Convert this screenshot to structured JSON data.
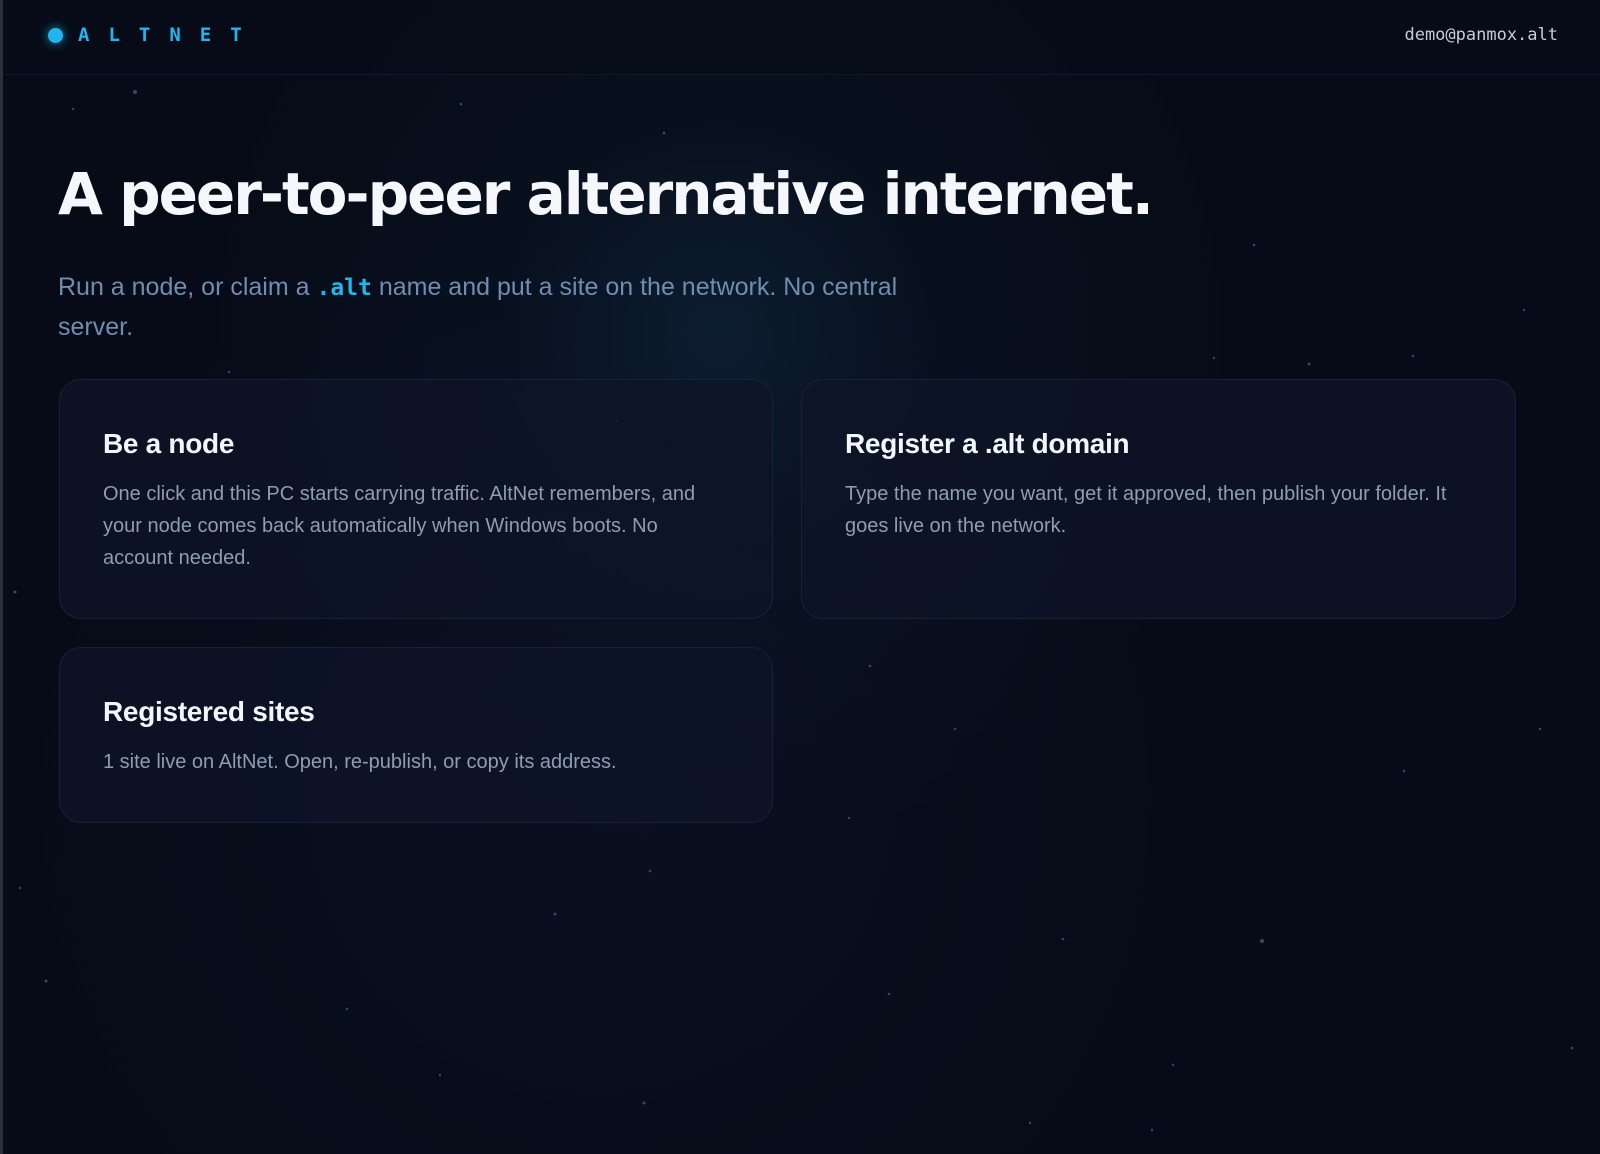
{
  "topbar": {
    "brand": "ALTNET",
    "account": "demo@panmox.alt"
  },
  "hero": {
    "title": "A peer-to-peer alternative internet.",
    "subtitle_before": "Run a node, or claim a ",
    "subtitle_highlight": ".alt",
    "subtitle_after": " name and put a site on the network. No central server."
  },
  "cards": {
    "node": {
      "title": "Be a node",
      "text": "One click and this PC starts carrying traffic. AltNet remembers, and your node comes back automatically when Windows boots. No account needed."
    },
    "domain": {
      "title": "Register a .alt domain",
      "text": "Type the name you want, get it approved, then publish your folder. It goes live on the network."
    },
    "sites": {
      "title": "Registered sites",
      "text": "1 site live on AltNet. Open, re-publish, or copy its address."
    }
  },
  "colors": {
    "accent": "#1fb6f0",
    "background": "#070b17",
    "card": "#0e1428",
    "subtitle": "#6d8eb0"
  },
  "icons": {
    "brand": "status-dot-icon"
  }
}
